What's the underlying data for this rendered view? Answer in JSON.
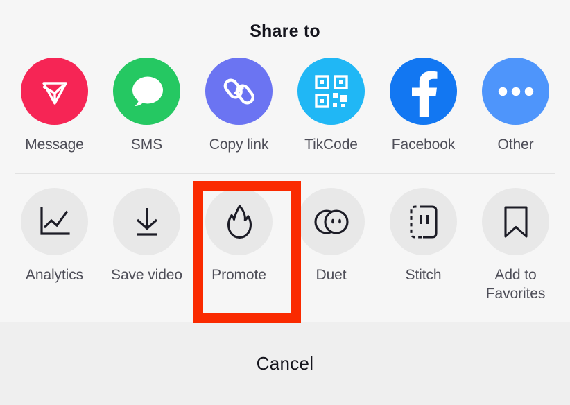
{
  "sheet": {
    "title": "Share to",
    "cancel_label": "Cancel"
  },
  "share_row": {
    "items": [
      {
        "label": "Message",
        "icon": "paper-plane-icon",
        "bg": "#F62555",
        "fg": "#FFFFFF"
      },
      {
        "label": "SMS",
        "icon": "speech-bubble-icon",
        "bg": "#25C862",
        "fg": "#FFFFFF"
      },
      {
        "label": "Copy link",
        "icon": "chain-link-icon",
        "bg": "#6B74F2",
        "fg": "#FFFFFF"
      },
      {
        "label": "TikCode",
        "icon": "qr-code-icon",
        "bg": "#20B7F5",
        "fg": "#FFFFFF"
      },
      {
        "label": "Facebook",
        "icon": "facebook-f-icon",
        "bg": "#1277F2",
        "fg": "#FFFFFF"
      },
      {
        "label": "Other",
        "icon": "ellipsis-icon",
        "bg": "#4E95FB",
        "fg": "#FFFFFF"
      }
    ]
  },
  "action_row": {
    "items": [
      {
        "label": "Analytics",
        "icon": "line-chart-icon",
        "bg": "#E8E8E8",
        "fg": "#1C1C26"
      },
      {
        "label": "Save video",
        "icon": "download-icon",
        "bg": "#E8E8E8",
        "fg": "#1C1C26"
      },
      {
        "label": "Promote",
        "icon": "flame-icon",
        "bg": "#E8E8E8",
        "fg": "#1C1C26"
      },
      {
        "label": "Duet",
        "icon": "duet-circles-icon",
        "bg": "#E8E8E8",
        "fg": "#1C1C26"
      },
      {
        "label": "Stitch",
        "icon": "stitch-frame-icon",
        "bg": "#E8E8E8",
        "fg": "#1C1C26"
      },
      {
        "label": "Add to Favorites",
        "icon": "bookmark-icon",
        "bg": "#E8E8E8",
        "fg": "#1C1C26"
      }
    ]
  },
  "annotation": {
    "highlight_color": "#FA2A00",
    "highlight_target": "Promote"
  }
}
